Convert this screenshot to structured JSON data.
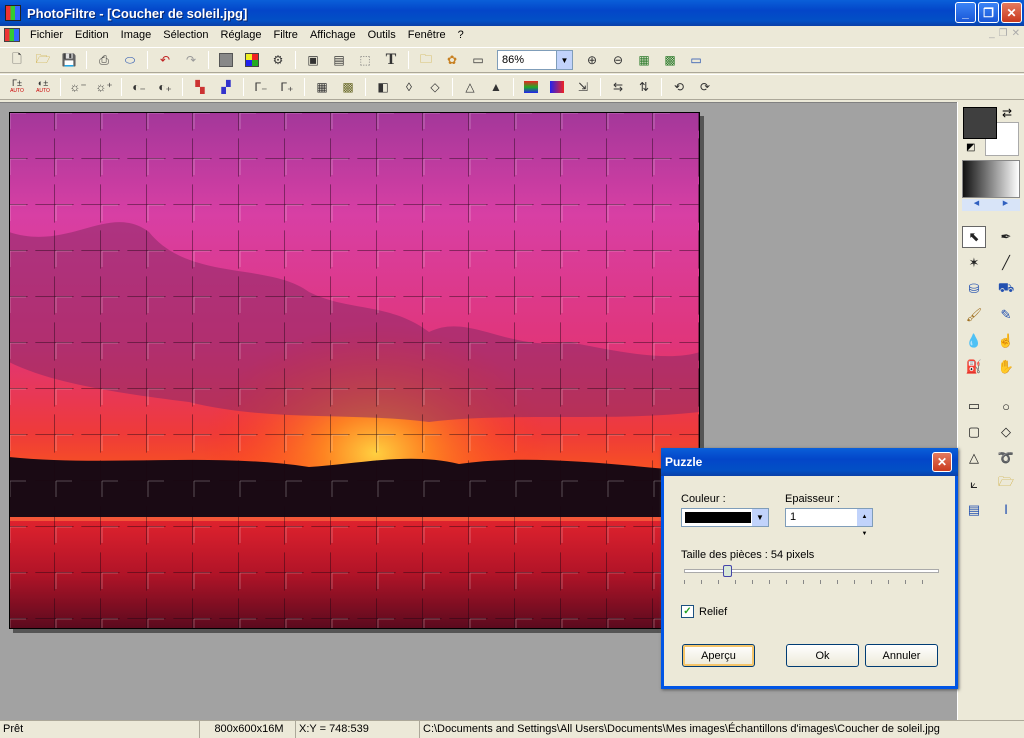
{
  "window": {
    "title": "PhotoFiltre - [Coucher de soleil.jpg]"
  },
  "menu": [
    "Fichier",
    "Edition",
    "Image",
    "Sélection",
    "Réglage",
    "Filtre",
    "Affichage",
    "Outils",
    "Fenêtre",
    "?"
  ],
  "toolbar": {
    "zoom_value": "86%",
    "text_tool_glyph": "T"
  },
  "toolbar2": {
    "auto_label_1": "AUTO",
    "auto_label_2": "AUTO"
  },
  "dialog": {
    "title": "Puzzle",
    "couleur_label": "Couleur :",
    "couleur_value": "#000000",
    "epaisseur_label": "Epaisseur :",
    "epaisseur_value": "1",
    "taille_label": "Taille des pièces : 54 pixels",
    "slider_fraction": 0.17,
    "relief_label": "Relief",
    "relief_checked": true,
    "apercu_label": "Aperçu",
    "ok_label": "Ok",
    "annuler_label": "Annuler"
  },
  "statusbar": {
    "state": "Prêt",
    "image_info": "800x600x16M",
    "coords": "X:Y = 748:539",
    "path": "C:\\Documents and Settings\\All Users\\Documents\\Mes images\\Échantillons d'images\\Coucher de soleil.jpg"
  },
  "colors": {
    "foreground": "#3f3f3f",
    "background": "#ffffff",
    "titlebar": "#0346c9"
  }
}
